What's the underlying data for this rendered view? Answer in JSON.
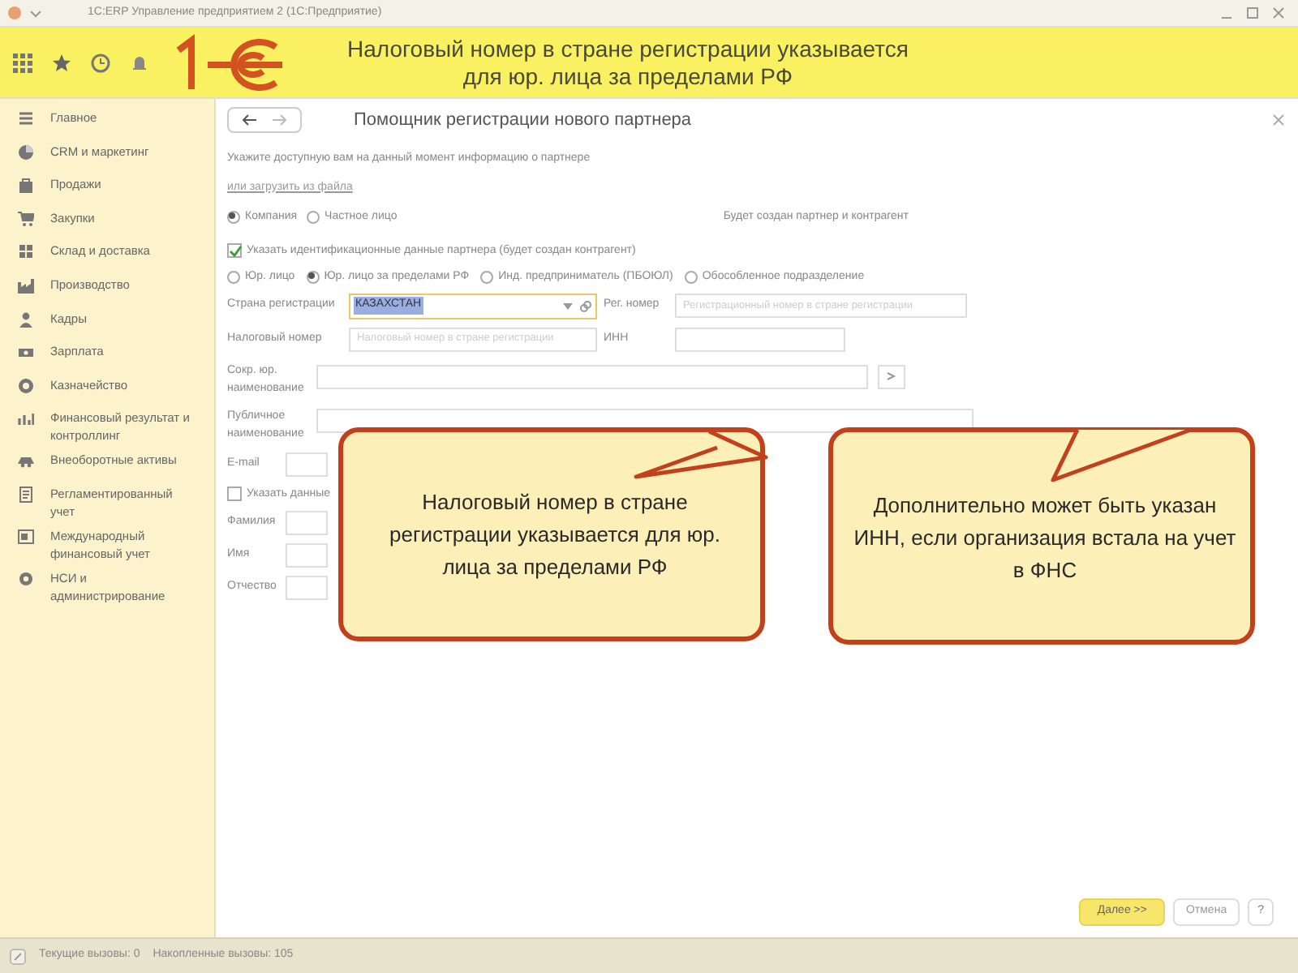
{
  "window": {
    "title": "1С:ERP Управление предприятием 2 (1С:Предприятие)"
  },
  "annotation_banner": {
    "lines": [
      "Налоговый номер в стране регистрации указывается",
      "для юр. лица за пределами РФ"
    ]
  },
  "sidebar": {
    "items": [
      {
        "label": "Главное",
        "kind": "lines"
      },
      {
        "label": "CRM и маркетинг",
        "kind": "pie"
      },
      {
        "label": "Продажи",
        "kind": "bag"
      },
      {
        "label": "Закупки",
        "kind": "cart"
      },
      {
        "label": "Склад и доставка",
        "kind": "grid"
      },
      {
        "label": "Производство",
        "kind": "factory"
      },
      {
        "label": "Кадры",
        "kind": "person"
      },
      {
        "label": "Зарплата",
        "kind": "money"
      },
      {
        "label": "Казначейство",
        "kind": "coin"
      },
      {
        "label": "Финансовый результат и контроллинг",
        "kind": "chart"
      },
      {
        "label": "Внеоборотные активы",
        "kind": "car"
      },
      {
        "label": "Регламентированный учет",
        "kind": "doc"
      },
      {
        "label": "Международный финансовый учет",
        "kind": "doc2"
      },
      {
        "label": "НСИ и администрирование",
        "kind": "gear"
      }
    ]
  },
  "form": {
    "title": "Помощник регистрации нового партнера",
    "hint": "Укажите доступную вам на данный момент информацию о партнере",
    "load_link": "или загрузить из файла",
    "partner_types": [
      {
        "label": "Компания",
        "selected": true
      },
      {
        "label": "Частное лицо",
        "selected": false
      }
    ],
    "result_note": "Будет создан партнер и контрагент",
    "identification": {
      "label": "Указать идентификационные данные партнера (будет создан контрагент)",
      "checked": true
    },
    "legal_forms": [
      {
        "label": "Юр. лицо",
        "selected": false
      },
      {
        "label": "Юр. лицо за пределами РФ",
        "selected": true
      },
      {
        "label": "Инд. предприниматель (ПБОЮЛ)",
        "selected": false
      },
      {
        "label": "Обособленное подразделение",
        "selected": false
      }
    ],
    "country": {
      "label": "Страна регистрации",
      "value": "КАЗАХСТАН"
    },
    "reg_number": {
      "label": "Рег. номер",
      "placeholder": "Регистрационный номер в стране регистрации"
    },
    "tax_number": {
      "label": "Налоговый номер",
      "placeholder": "Налоговый номер в стране регистрации"
    },
    "inn": {
      "label": "ИНН"
    },
    "short_name": {
      "label": "Сокр. юр. наименование"
    },
    "public_name": {
      "label": "Публичное наименование"
    },
    "email": {
      "label": "E-mail"
    },
    "person_data": {
      "label": "Указать данные",
      "checked": false
    },
    "person_fields": [
      {
        "label": "Фамилия"
      },
      {
        "label": "Имя"
      },
      {
        "label": "Отчество"
      }
    ],
    "buttons": {
      "next": "Далее >>",
      "cancel": "Отмена",
      "help": "?"
    }
  },
  "callouts": [
    {
      "text": "Налоговый номер в стране регистрации указывается для юр. лица за пределами РФ"
    },
    {
      "text": "Дополнительно может быть указан ИНН, если организация встала на учет в ФНС"
    }
  ],
  "status_bar": {
    "items": [
      "Текущие вызовы: 0",
      "Накопленные вызовы: 105"
    ]
  }
}
